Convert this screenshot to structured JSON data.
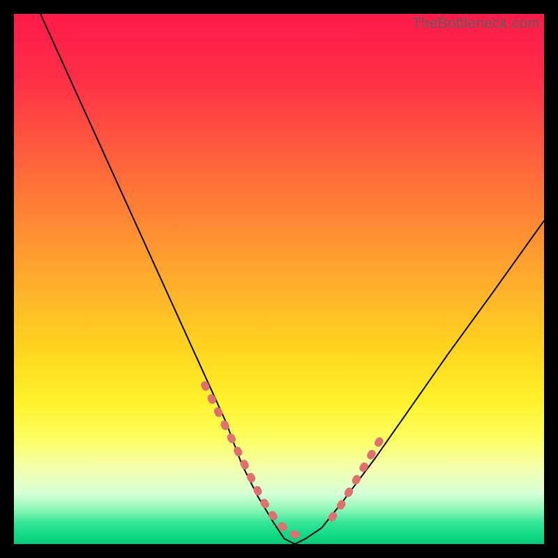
{
  "watermark": "TheBottleneck.com",
  "chart_data": {
    "type": "line",
    "title": "",
    "xlabel": "",
    "ylabel": "",
    "xlim": [
      0,
      100
    ],
    "ylim": [
      0,
      100
    ],
    "grid": false,
    "legend": false,
    "series": [
      {
        "name": "bottleneck-curve",
        "x": [
          5,
          10,
          15,
          20,
          25,
          30,
          35,
          40,
          43,
          46,
          49,
          51,
          53,
          55,
          58,
          62,
          68,
          75,
          82,
          90,
          100
        ],
        "y": [
          100,
          89,
          78,
          67,
          56,
          45,
          34,
          23,
          15,
          9,
          4,
          1,
          0,
          1,
          3,
          8,
          16,
          26,
          36,
          47,
          61
        ],
        "color": "#000000"
      },
      {
        "name": "highlight-dots-left",
        "x": [
          36,
          37.5,
          39,
          40.5,
          42,
          43.5,
          45,
          46.5,
          48,
          49.5,
          51,
          52.5,
          54,
          55.5
        ],
        "y": [
          30,
          27,
          24,
          21,
          18,
          15,
          12,
          9,
          6.5,
          4.5,
          3,
          2,
          1.5,
          1.3
        ],
        "color": "#e07070",
        "style": "dotted-thick"
      },
      {
        "name": "highlight-dots-right",
        "x": [
          60,
          61.5,
          63,
          64.5,
          66,
          67.5,
          69
        ],
        "y": [
          5,
          7,
          9.5,
          12,
          14.5,
          17,
          19.5
        ],
        "color": "#e07070",
        "style": "dotted-thick"
      }
    ],
    "background_gradient": {
      "stops": [
        {
          "offset": 0.0,
          "color": "#ff1a49"
        },
        {
          "offset": 0.12,
          "color": "#ff2e47"
        },
        {
          "offset": 0.3,
          "color": "#ff6a3a"
        },
        {
          "offset": 0.48,
          "color": "#ffa52f"
        },
        {
          "offset": 0.62,
          "color": "#ffd11f"
        },
        {
          "offset": 0.73,
          "color": "#fff22a"
        },
        {
          "offset": 0.8,
          "color": "#fdff60"
        },
        {
          "offset": 0.86,
          "color": "#f2ffb0"
        },
        {
          "offset": 0.905,
          "color": "#d6ffd6"
        },
        {
          "offset": 0.935,
          "color": "#8cf7b6"
        },
        {
          "offset": 0.96,
          "color": "#33e597"
        },
        {
          "offset": 0.985,
          "color": "#0fd885"
        },
        {
          "offset": 1.0,
          "color": "#07c879"
        }
      ]
    }
  }
}
